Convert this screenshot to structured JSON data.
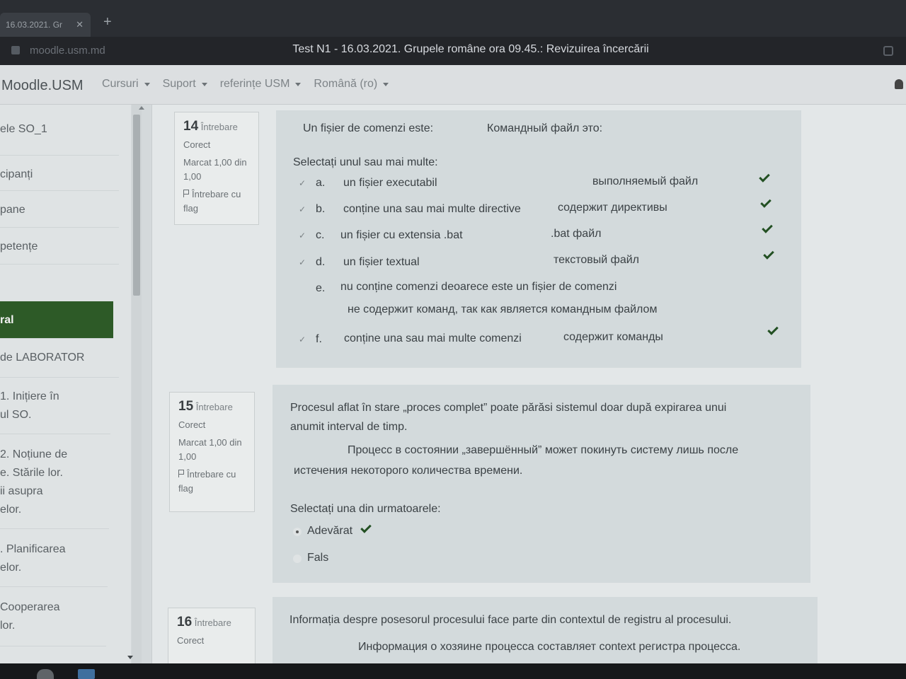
{
  "browser": {
    "tab_title": "16.03.2021. Gr",
    "tab_close": "✕",
    "new_tab": "+",
    "url": "moodle.usm.md",
    "window_title": "Test N1 - 16.03.2021. Grupele române ora 09.45.: Revizuirea încercării"
  },
  "navbar": {
    "brand": "Moodle.USM",
    "menu": [
      {
        "label": "Cursuri"
      },
      {
        "label": "Suport"
      },
      {
        "label": "referințe USM"
      },
      {
        "label": "Română (ro)"
      }
    ]
  },
  "drawer": {
    "items": [
      {
        "label": "ele SO_1"
      },
      {
        "label": "cipanți"
      },
      {
        "label": "pane"
      },
      {
        "label": "petențe"
      },
      {
        "label": "ral",
        "active": true
      },
      {
        "label": "de LABORATOR"
      },
      {
        "label": "1. Inițiere în\nul SO."
      },
      {
        "label": "2. Noțiune de\ne. Stările lor.\nii asupra\nelor."
      },
      {
        "label": ". Planificarea\nelor."
      },
      {
        "label": "Cooperarea\nlor."
      }
    ]
  },
  "questions": [
    {
      "number": "14",
      "label": "Întrebare",
      "status": "Corect",
      "marks": "Marcat 1,00 din 1,00",
      "flag": "Întrebare cu flag",
      "text_ro": "Un fișier de comenzi este:",
      "text_ru": "Командный файл это:",
      "prompt": "Selectați unul sau mai multe:",
      "options": [
        {
          "letter": "a.",
          "text": "un fișier executabil",
          "ru": "выполняемый файл",
          "checked": "✓"
        },
        {
          "letter": "b.",
          "text": "conține una sau mai multe directive",
          "ru": "содержит директивы",
          "checked": "✓"
        },
        {
          "letter": "c.",
          "text": "un fișier cu extensia .bat",
          "ru": ".bat  файл",
          "checked": "✓"
        },
        {
          "letter": "d.",
          "text": "un fișier textual",
          "ru": "текстовый файл",
          "checked": "✓"
        },
        {
          "letter": "e.",
          "text": "nu conține comenzi deoarece este un fișier de comenzi",
          "ru": "не содержит команд, так как является командным файлом",
          "checked": ""
        },
        {
          "letter": "f.",
          "text": "conține una sau mai multe comenzi",
          "ru": "содержит команды",
          "checked": "✓"
        }
      ]
    },
    {
      "number": "15",
      "label": "Întrebare",
      "status": "Corect",
      "marks": "Marcat 1,00 din 1,00",
      "flag": "Întrebare cu flag",
      "text_ro_1": "Procesul aflat în stare „proces complet” poate părăsi sistemul   doar după expirarea unui",
      "text_ro_2": "anumit interval de timp.",
      "text_ru_1": "Процесс в состоянии  „завершённый” может покинуть систему лишь после",
      "text_ru_2": "истечения некоторого количества времени.",
      "prompt": "Selectați una din urmatoarele:",
      "options": [
        {
          "text": "Adevărat",
          "selected": true
        },
        {
          "text": "Fals",
          "selected": false
        }
      ]
    },
    {
      "number": "16",
      "label": "Întrebare",
      "status": "Corect",
      "text_ro": "Informația despre posesorul procesului face parte din contextul de registru al procesului.",
      "text_ru": "Информация  о хозяине процесса составляет  context  регистра  процесса."
    }
  ],
  "colors": {
    "accent_green": "#2d5a27",
    "check_green": "#235023"
  }
}
